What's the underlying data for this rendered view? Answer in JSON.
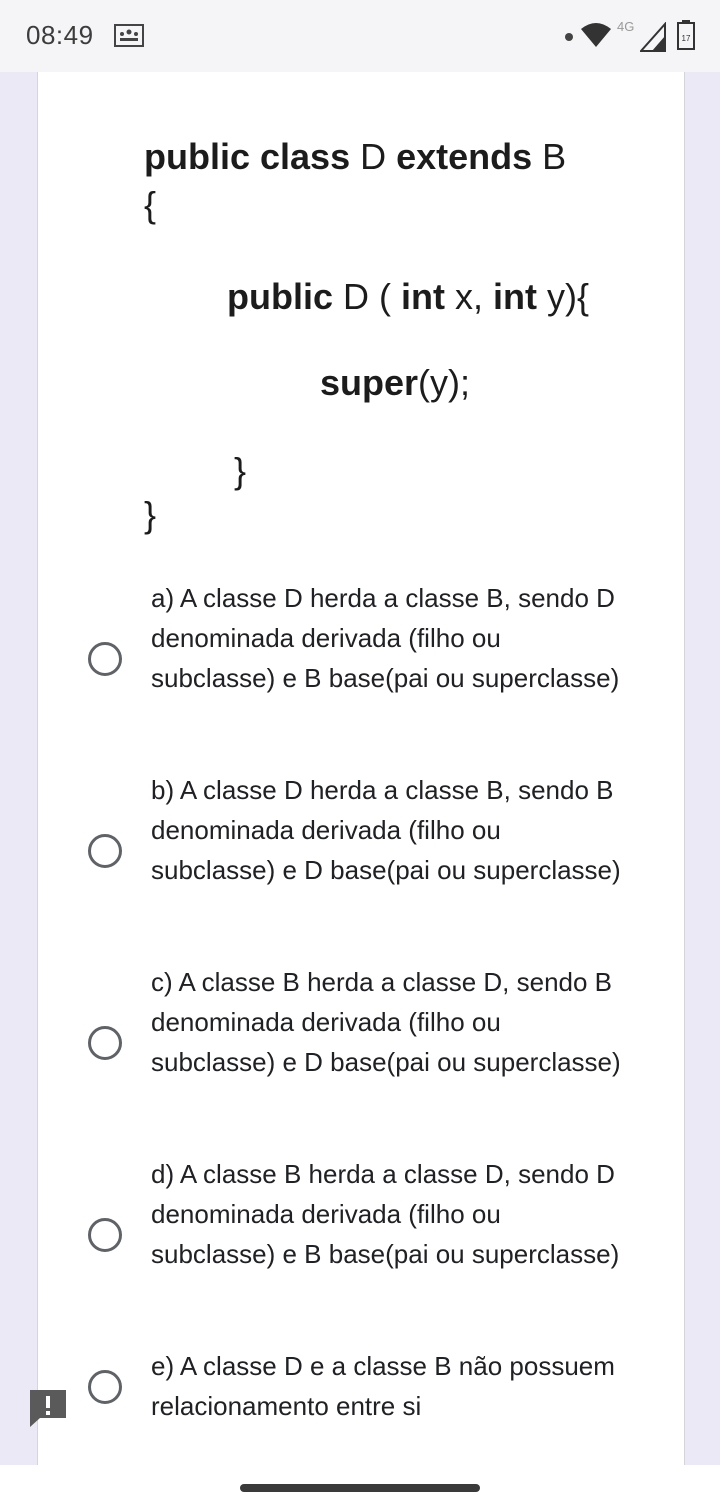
{
  "status_bar": {
    "time": "08:49",
    "network": "4G",
    "battery": "17",
    "icons": [
      "notification-icon",
      "wifi-icon",
      "signal-icon",
      "battery-icon"
    ]
  },
  "question": {
    "code_lines": {
      "l1_bold1": "public class",
      "l1_mid": " D ",
      "l1_bold2": "extends",
      "l1_end": " B",
      "l2": "{",
      "l3_bold1": "public",
      "l3_mid1": " D ( ",
      "l3_bold2": "int",
      "l3_mid2": " x, ",
      "l3_bold3": "int",
      "l3_end": " y){",
      "l4_bold": "super",
      "l4_end": "(y);",
      "l5": "}",
      "l6": "}"
    }
  },
  "options": [
    {
      "text": "a) A classe D herda a classe B, sendo D denominada derivada (filho ou subclasse) e B base(pai ou superclasse)"
    },
    {
      "text": "b) A classe D herda a classe B, sendo B denominada derivada (filho ou subclasse) e D base(pai ou superclasse)"
    },
    {
      "text": "c) A classe B herda a classe D, sendo B denominada derivada (filho ou subclasse) e D base(pai ou superclasse)"
    },
    {
      "text": "d) A classe B herda a classe D, sendo D denominada derivada (filho ou subclasse) e B base(pai ou superclasse)"
    },
    {
      "text": "e) A classe D e a classe B não possuem relacionamento entre si"
    }
  ],
  "colors": {
    "side_background": "#ece9f6",
    "radio_border": "#5f6368",
    "text": "#202124"
  }
}
